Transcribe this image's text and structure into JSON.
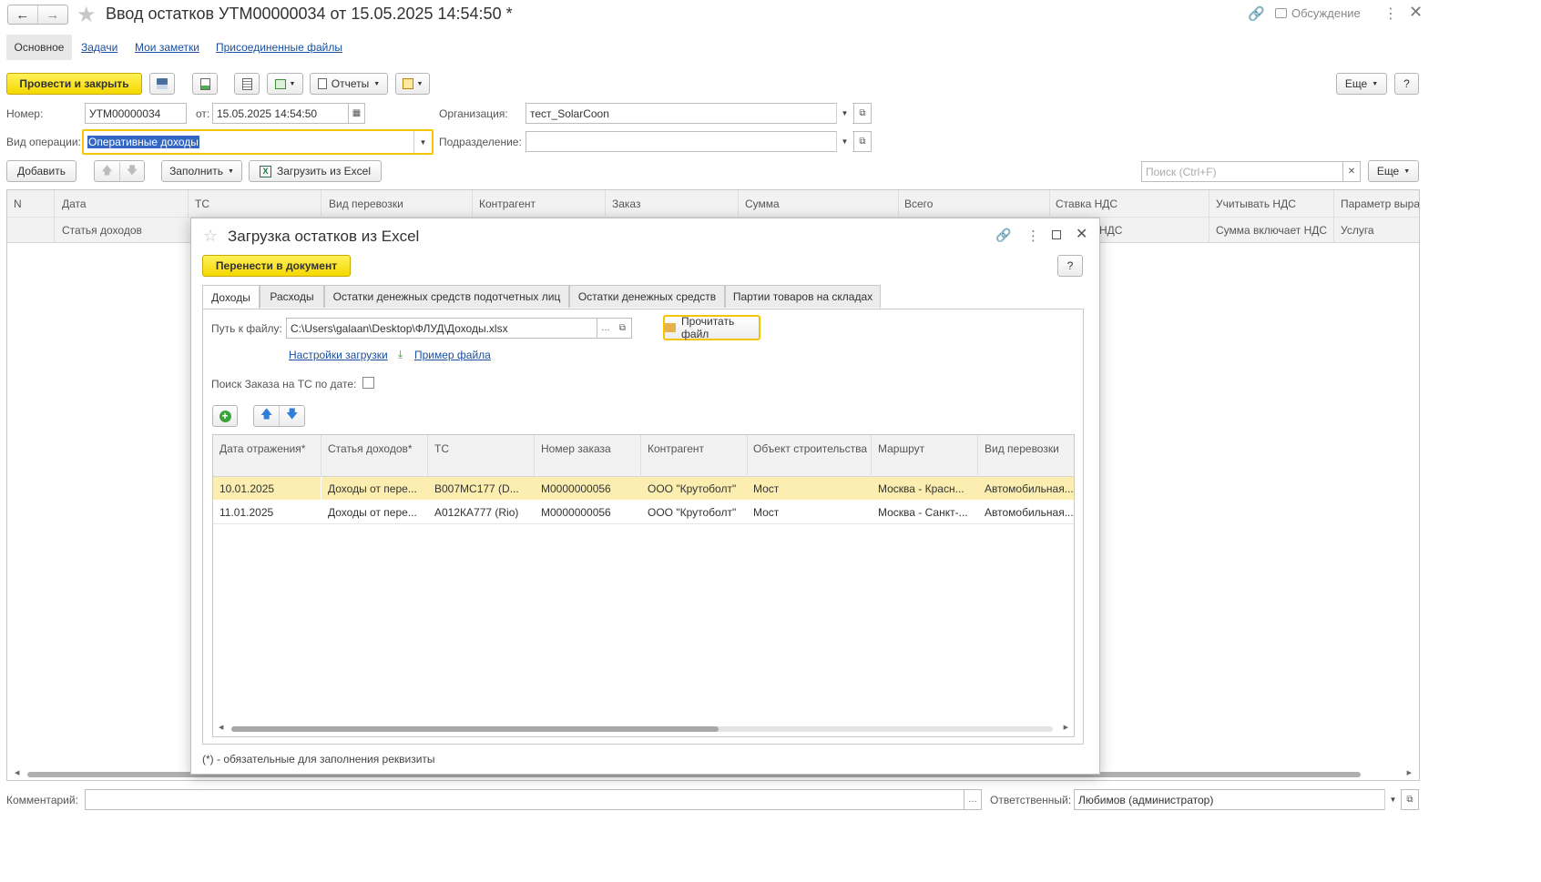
{
  "window": {
    "title": "Ввод остатков УТМ00000034 от 15.05.2025 14:54:50 *",
    "discussion_label": "Обсуждение"
  },
  "nav_tabs": [
    {
      "label": "Основное"
    },
    {
      "label": "Задачи"
    },
    {
      "label": "Мои заметки"
    },
    {
      "label": "Присоединенные файлы"
    }
  ],
  "toolbar": {
    "post_close_label": "Провести и закрыть",
    "reports_label": "Отчеты",
    "more_label": "Еще",
    "help_label": "?"
  },
  "header_fields": {
    "number_label": "Номер:",
    "number_value": "УТМ00000034",
    "date_label": "от:",
    "date_value": "15.05.2025 14:54:50",
    "org_label": "Организация:",
    "org_value": "тест_SolarCoon",
    "op_label": "Вид операции:",
    "op_value": "Оперативные доходы",
    "dept_label": "Подразделение:",
    "dept_value": ""
  },
  "table_toolbar": {
    "add_label": "Добавить",
    "fill_label": "Заполнить",
    "excel_label": "Загрузить из Excel",
    "search_placeholder": "Поиск (Ctrl+F)",
    "more_label": "Еще"
  },
  "main_table": {
    "headers_row1": [
      "N",
      "Дата",
      "ТС",
      "Вид перевозки",
      "Контрагент",
      "Заказ",
      "Сумма",
      "Всего",
      "Ставка НДС",
      "Учитывать НДС",
      "Параметр выра"
    ],
    "headers_row2": [
      "Статья доходов",
      "НДС",
      "Сумма включает НДС",
      "Услуга"
    ]
  },
  "footer": {
    "comment_label": "Комментарий:",
    "comment_value": "",
    "responsible_label": "Ответственный:",
    "responsible_value": "Любимов (администратор)"
  },
  "dialog": {
    "title": "Загрузка остатков из Excel",
    "transfer_label": "Перенести в документ",
    "help_label": "?",
    "tabs": [
      {
        "label": "Доходы"
      },
      {
        "label": "Расходы"
      },
      {
        "label": "Остатки денежных средств подотчетных лиц"
      },
      {
        "label": "Остатки денежных средств"
      },
      {
        "label": "Партии товаров на складах"
      }
    ],
    "path_label": "Путь к файлу:",
    "path_value": "C:\\Users\\galaan\\Desktop\\ФЛУД\\Доходы.xlsx",
    "read_file_label": "Прочитать файл",
    "settings_link": "Настройки загрузки",
    "example_link": "Пример файла",
    "search_order_label": "Поиск Заказа на ТС по дате:",
    "note": "(*) - обязательные для заполнения реквизиты",
    "grid": {
      "headers": [
        "Дата отражения*",
        "Статья доходов*",
        "ТС",
        "Номер заказа",
        "Контрагент",
        "Объект строительства",
        "Маршрут",
        "Вид перевозки"
      ],
      "rows": [
        [
          "10.01.2025",
          "Доходы от пере...",
          "В007МС177 (D...",
          "М0000000056",
          "ООО \"Крутоболт\"",
          "Мост",
          "Москва - Красн...",
          "Автомобильная..."
        ],
        [
          "11.01.2025",
          "Доходы от пере...",
          "А012КА777 (Rio)",
          "М0000000056",
          "ООО \"Крутоболт\"",
          "Мост",
          "Москва - Санкт-...",
          "Автомобильная..."
        ]
      ]
    }
  }
}
